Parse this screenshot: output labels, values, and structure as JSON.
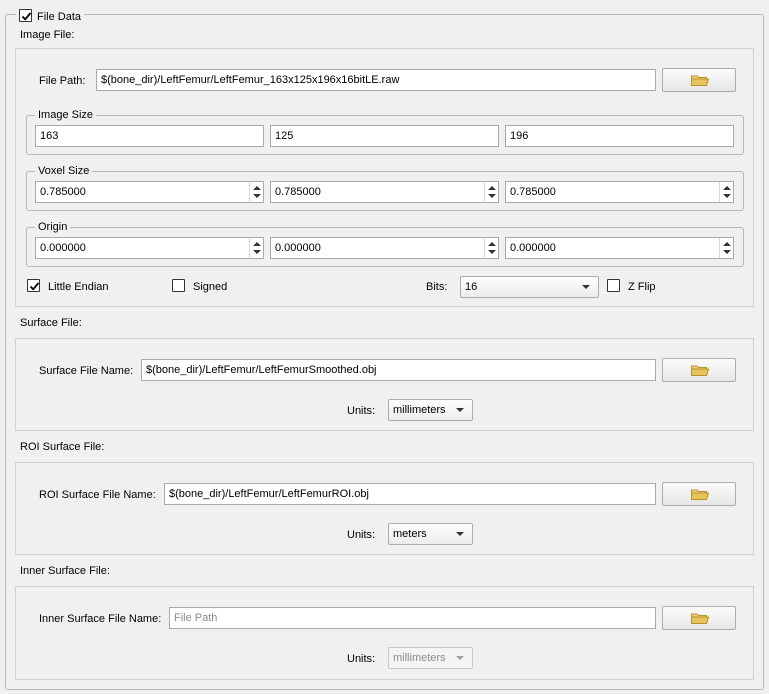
{
  "file_data": {
    "title": "File Data",
    "checked": true
  },
  "image_file": {
    "section_label": "Image File:",
    "file_path_label": "File Path:",
    "file_path_value": "$(bone_dir)/LeftFemur/LeftFemur_163x125x196x16bitLE.raw",
    "image_size": {
      "title": "Image Size",
      "values": [
        "163",
        "125",
        "196"
      ]
    },
    "voxel_size": {
      "title": "Voxel Size",
      "values": [
        "0.785000",
        "0.785000",
        "0.785000"
      ]
    },
    "origin": {
      "title": "Origin",
      "values": [
        "0.000000",
        "0.000000",
        "0.000000"
      ]
    },
    "little_endian_label": "Little Endian",
    "little_endian_checked": true,
    "signed_label": "Signed",
    "signed_checked": false,
    "bits_label": "Bits:",
    "bits_value": "16",
    "zflip_label": "Z Flip",
    "zflip_checked": false
  },
  "surface_file": {
    "section_label": "Surface File:",
    "name_label": "Surface File Name:",
    "name_value": "$(bone_dir)/LeftFemur/LeftFemurSmoothed.obj",
    "units_label": "Units:",
    "units_value": "millimeters"
  },
  "roi_surface_file": {
    "section_label": "ROI Surface File:",
    "name_label": "ROI Surface File Name:",
    "name_value": "$(bone_dir)/LeftFemur/LeftFemurROI.obj",
    "units_label": "Units:",
    "units_value": "meters"
  },
  "inner_surface_file": {
    "section_label": "Inner Surface File:",
    "name_label": "Inner Surface File Name:",
    "name_placeholder": "File Path",
    "units_label": "Units:",
    "units_value": "millimeters"
  },
  "icons": {
    "browse": "folder-icon",
    "check": "checkmark-icon"
  },
  "colors": {
    "background": "#f0f0f0",
    "folder": "#e8c35a",
    "border": "#a9a9a9"
  }
}
